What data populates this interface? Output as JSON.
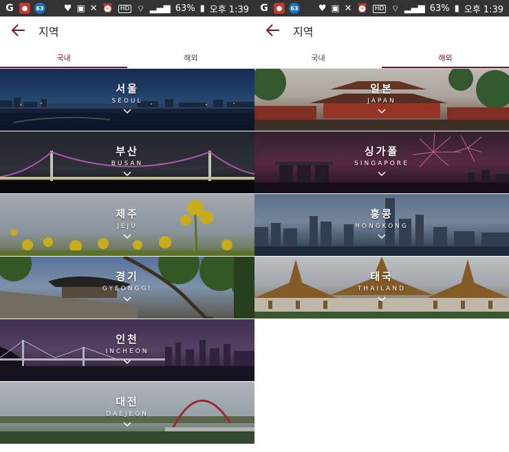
{
  "status_bar": {
    "left_icons": [
      "G",
      "●",
      "63"
    ],
    "battery": "63%",
    "time": "오후 1:39",
    "hd": "HD"
  },
  "header": {
    "title": "지역"
  },
  "tabs": {
    "domestic": "국내",
    "overseas": "해외"
  },
  "domestic_regions": [
    {
      "ko": "서울",
      "en": "SEOUL"
    },
    {
      "ko": "부산",
      "en": "BUSAN"
    },
    {
      "ko": "제주",
      "en": "JEJU"
    },
    {
      "ko": "경기",
      "en": "GYEONGGI"
    },
    {
      "ko": "인천",
      "en": "INCHEON"
    },
    {
      "ko": "대전",
      "en": "DAEJEON"
    }
  ],
  "overseas_regions": [
    {
      "ko": "일본",
      "en": "JAPAN"
    },
    {
      "ko": "싱가폴",
      "en": "SINGAPORE"
    },
    {
      "ko": "홍콩",
      "en": "HONGKONG"
    },
    {
      "ko": "태국",
      "en": "THAILAND"
    }
  ],
  "colors": {
    "accent": "#6b0f2b",
    "statusbar": "#333333"
  }
}
